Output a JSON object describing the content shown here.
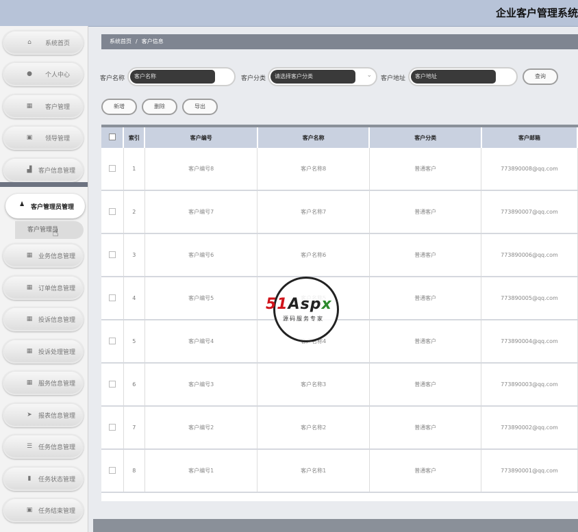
{
  "header": {
    "title": "企业客户管理系统"
  },
  "sidebar": {
    "items": [
      {
        "label": "系统首页",
        "icon": "home-icon",
        "glyph": "⌂"
      },
      {
        "label": "个人中心",
        "icon": "user-icon",
        "glyph": "●"
      },
      {
        "label": "客户管理",
        "icon": "grid-icon",
        "glyph": "▦"
      },
      {
        "label": "领导管理",
        "icon": "clipboard-icon",
        "glyph": "▣"
      },
      {
        "label": "客户信息管理",
        "icon": "chart-icon",
        "glyph": "▟"
      }
    ],
    "active": {
      "label": "客户管理员管理",
      "icon": "user-icon",
      "glyph": "♟",
      "sub_label": "客户管理员"
    },
    "items_after": [
      {
        "label": "业务信息管理",
        "icon": "grid-icon",
        "glyph": "▦"
      },
      {
        "label": "订单信息管理",
        "icon": "grid-icon",
        "glyph": "▦"
      },
      {
        "label": "投诉信息管理",
        "icon": "grid-icon",
        "glyph": "▦"
      },
      {
        "label": "投诉处理管理",
        "icon": "grid-icon",
        "glyph": "▦"
      },
      {
        "label": "服务信息管理",
        "icon": "grid-icon",
        "glyph": "▦"
      },
      {
        "label": "报表信息管理",
        "icon": "send-icon",
        "glyph": "➤"
      },
      {
        "label": "任务信息管理",
        "icon": "sliders-icon",
        "glyph": "☰"
      },
      {
        "label": "任务状态管理",
        "icon": "bar-chart-icon",
        "glyph": "▮"
      },
      {
        "label": "任务结束管理",
        "icon": "clipboard-icon",
        "glyph": "▣"
      }
    ]
  },
  "breadcrumb": {
    "home": "系统首页",
    "separator": "/",
    "current": "客户信息"
  },
  "search": {
    "name_label": "客户名称",
    "name_placeholder": "客户名称",
    "category_label": "客户分类",
    "category_placeholder": "请选择客户分类",
    "address_label": "客户地址",
    "address_placeholder": "客户地址",
    "query_button": "查询"
  },
  "actions": {
    "add": "新增",
    "delete": "删除",
    "export": "导出"
  },
  "table": {
    "headers": {
      "index": "索引",
      "code": "客户编号",
      "name": "客户名称",
      "category": "客户分类",
      "email": "客户邮箱"
    },
    "rows": [
      {
        "index": "1",
        "code": "客户编号8",
        "name": "客户名称8",
        "category": "普通客户",
        "email": "773890008@qq.com"
      },
      {
        "index": "2",
        "code": "客户编号7",
        "name": "客户名称7",
        "category": "普通客户",
        "email": "773890007@qq.com"
      },
      {
        "index": "3",
        "code": "客户编号6",
        "name": "客户名称6",
        "category": "普通客户",
        "email": "773890006@qq.com"
      },
      {
        "index": "4",
        "code": "客户编号5",
        "name": "客户名称5",
        "category": "普通客户",
        "email": "773890005@qq.com"
      },
      {
        "index": "5",
        "code": "客户编号4",
        "name": "客户名称4",
        "category": "普通客户",
        "email": "773890004@qq.com"
      },
      {
        "index": "6",
        "code": "客户编号3",
        "name": "客户名称3",
        "category": "普通客户",
        "email": "773890003@qq.com"
      },
      {
        "index": "7",
        "code": "客户编号2",
        "name": "客户名称2",
        "category": "普通客户",
        "email": "773890002@qq.com"
      },
      {
        "index": "8",
        "code": "客户编号1",
        "name": "客户名称1",
        "category": "普通客户",
        "email": "773890001@qq.com"
      }
    ]
  },
  "watermark": {
    "brand_a": "51",
    "brand_b": "Asp",
    "brand_c": "x",
    "tagline": "源码服务专家"
  },
  "colors": {
    "header_bg": "#b7c3d8",
    "breadcrumb_bg": "#7f8591",
    "table_head_bg": "#c9d1e0"
  }
}
